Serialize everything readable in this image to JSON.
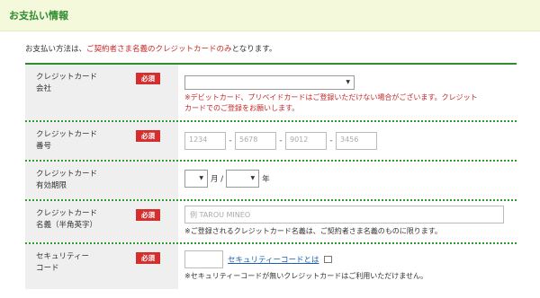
{
  "header": {
    "title": "お支払い情報"
  },
  "intro": {
    "prefix": "お支払い方法は、",
    "highlight": "ご契約者さま名義のクレジットカードのみ",
    "suffix": "となります。"
  },
  "required_label": "必須",
  "rows": {
    "company": {
      "label_line1": "クレジットカード",
      "label_line2": "会社",
      "selected": "",
      "note_line1": "※デビットカード、プリペイドカードはご登録いただけない場合がございます。クレジット",
      "note_line2": "カードでのご登録をお願いします。"
    },
    "number": {
      "label_line1": "クレジットカード",
      "label_line2": "番号",
      "placeholders": [
        "1234",
        "5678",
        "9012",
        "3456"
      ],
      "separator": "-"
    },
    "expiry": {
      "label_line1": "クレジットカード",
      "label_line2": "有効期限",
      "month_selected": "",
      "month_unit": "月 /",
      "year_selected": "",
      "year_unit": "年"
    },
    "name": {
      "label_line1": "クレジットカード",
      "label_line2": "名義（半角英字）",
      "placeholder": "例 TAROU MINEO",
      "note": "※ご登録されるクレジットカード名義は、ご契約者さま名義のものに限ります。"
    },
    "security": {
      "label_line1": "セキュリティー",
      "label_line2": "コード",
      "link": "セキュリティーコードとは",
      "note": "※セキュリティーコードが無いクレジットカードはご利用いただけません。"
    }
  },
  "colors": {
    "accent_green": "#2e8b2e",
    "header_bg": "#f4f9dc",
    "required_red": "#d32f2f",
    "note_red": "#c62828",
    "link_blue": "#1a5fb4"
  }
}
